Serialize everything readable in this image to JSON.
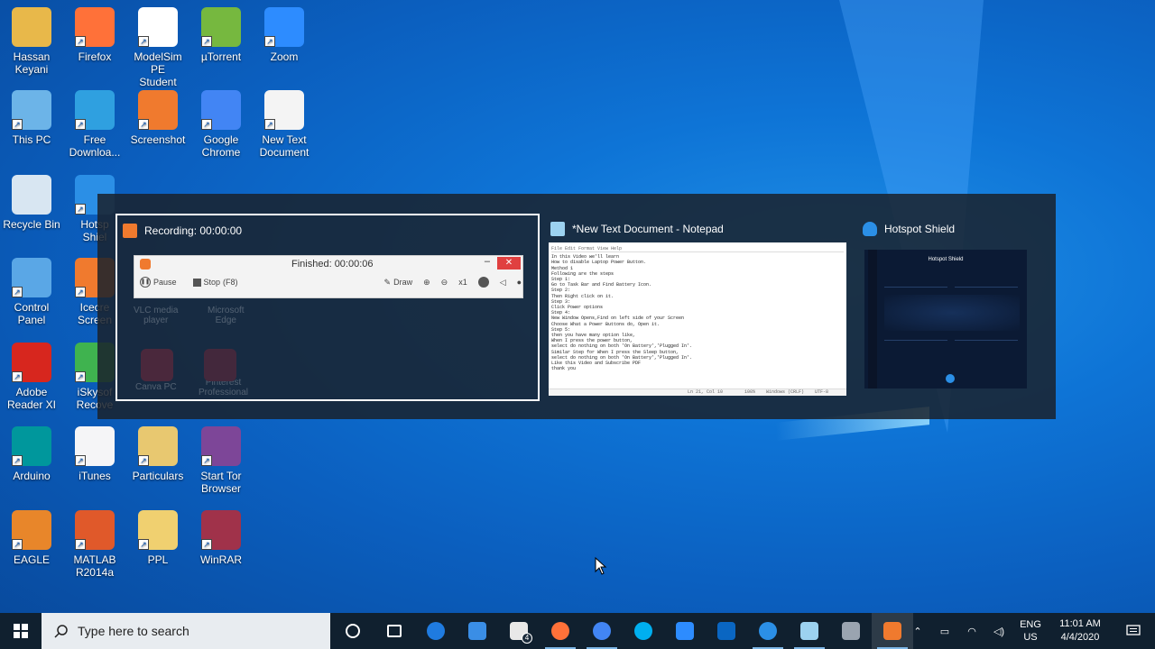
{
  "desktop": {
    "icons": [
      {
        "label": "Hassan\nKeyani",
        "icon": "user-folder-icon",
        "color": "#e8b84a"
      },
      {
        "label": "Firefox",
        "icon": "firefox-icon",
        "color": "#ff7139"
      },
      {
        "label": "ModelSim PE\nStudent Edi...",
        "icon": "modelsim-icon",
        "color": "#ffffff"
      },
      {
        "label": "µTorrent",
        "icon": "utorrent-icon",
        "color": "#76b83f"
      },
      {
        "label": "Zoom",
        "icon": "zoom-icon",
        "color": "#2d8cff"
      },
      {
        "label": "This PC",
        "icon": "this-pc-icon",
        "color": "#6cb4e8"
      },
      {
        "label": "Free\nDownloa...",
        "icon": "free-download-icon",
        "color": "#2fa0e0"
      },
      {
        "label": "Screenshot",
        "icon": "screenshot-icon",
        "color": "#f07a2e"
      },
      {
        "label": "Google\nChrome",
        "icon": "chrome-icon",
        "color": "#4285f4"
      },
      {
        "label": "New Text\nDocument",
        "icon": "text-document-icon",
        "color": "#f4f4f4"
      },
      {
        "label": "Recycle Bin",
        "icon": "recycle-bin-icon",
        "color": "#d8e6f2"
      },
      {
        "label": "Hotsp\nShiel",
        "icon": "hotspot-shield-icon",
        "color": "#2b8fe6"
      },
      {
        "label": "Control\nPanel",
        "icon": "control-panel-icon",
        "color": "#5aa7e6"
      },
      {
        "label": "Icecre\nScreen",
        "icon": "icecream-icon",
        "color": "#f07a2e"
      },
      {
        "label": "Adobe\nReader XI",
        "icon": "adobe-reader-icon",
        "color": "#d7261e"
      },
      {
        "label": "iSkysof\nRecove",
        "icon": "iskysoft-icon",
        "color": "#3fb34f"
      },
      {
        "label": "Arduino",
        "icon": "arduino-icon",
        "color": "#00979c"
      },
      {
        "label": "iTunes",
        "icon": "itunes-icon",
        "color": "#f5f5f7"
      },
      {
        "label": "Particulars",
        "icon": "folder-icon",
        "color": "#e8c870"
      },
      {
        "label": "Start Tor\nBrowser",
        "icon": "tor-icon",
        "color": "#7d4698"
      },
      {
        "label": "EAGLE",
        "icon": "eagle-icon",
        "color": "#e8862a"
      },
      {
        "label": "MATLAB\nR2014a",
        "icon": "matlab-icon",
        "color": "#e0592a"
      },
      {
        "label": "PPL",
        "icon": "folder-icon",
        "color": "#f0d070"
      },
      {
        "label": "WinRAR",
        "icon": "winrar-icon",
        "color": "#a0324a"
      }
    ]
  },
  "switcher": {
    "recording": {
      "title": "Recording:  00:00:00",
      "finished_label": "Finished:  00:00:06",
      "pause_label": "Pause",
      "stop_label": "Stop",
      "stop_hotkey": "(F8)",
      "draw_label": "Draw",
      "zoom_label": "x1",
      "bg_texts": [
        "VLC media\nplayer",
        "Microsoft\nEdge",
        "Canva PC",
        "Pinterest\nProfessional"
      ],
      "accent": "#f07a2e"
    },
    "notepad": {
      "title": "*New Text Document - Notepad",
      "menu": "File  Edit  Format  View  Help",
      "lines": [
        "In this Video we'll learn",
        "How to disable Laptop Power Button.",
        "Method 1",
        "Following are the steps",
        "Step 1:",
        "Go to Task Bar and Find Battery Icon.",
        "Step 2:",
        "Then Right click on it.",
        "Step 3:",
        "Click Power options",
        "Step 4:",
        "New Window Opens,Find on left side of your Screen",
        "Choose What a Power Buttons do, Open it.",
        "Step 5:",
        "then you have many option like,",
        "When I press the power button,",
        "select do nothing on both 'On Battery','Plugged In'.",
        "Similar Step for When I press the Sleep button,",
        "select do nothing on both 'On Battery','Plugged In'.",
        "Like this Video and Subscribe PDF",
        "thank you"
      ],
      "status": "Ln 21, Col 10        100%    Windows (CRLF)    UTF-8"
    },
    "hotspot": {
      "title": "Hotspot Shield",
      "app_name": "Hotspot Shield",
      "accent": "#2b8fe6"
    }
  },
  "taskbar": {
    "search_placeholder": "Type here to search",
    "apps": [
      {
        "name": "cortana",
        "icon": "cortana-icon",
        "color": "#ffffff"
      },
      {
        "name": "task-view",
        "icon": "task-view-icon",
        "color": "#ffffff"
      },
      {
        "name": "edge",
        "icon": "edge-icon",
        "color": "#1f7be0"
      },
      {
        "name": "store",
        "icon": "store-icon",
        "color": "#3a8ee6"
      },
      {
        "name": "mail",
        "icon": "mail-icon",
        "color": "#e8e8e8",
        "badge": "4"
      },
      {
        "name": "firefox",
        "icon": "firefox-icon",
        "color": "#ff7139"
      },
      {
        "name": "chrome",
        "icon": "chrome-icon",
        "color": "#4285f4"
      },
      {
        "name": "skype",
        "icon": "skype-icon",
        "color": "#00aff0"
      },
      {
        "name": "zoom",
        "icon": "zoom-icon",
        "color": "#2d8cff"
      },
      {
        "name": "linkedin",
        "icon": "linkedin-icon",
        "color": "#0a66c2"
      },
      {
        "name": "hotspot-shield",
        "icon": "hotspot-shield-icon",
        "color": "#2b8fe6"
      },
      {
        "name": "notepad",
        "icon": "notepad-icon",
        "color": "#9cd2f0"
      },
      {
        "name": "bug-app",
        "icon": "bug-icon",
        "color": "#9aa4b0"
      },
      {
        "name": "recorder",
        "icon": "recorder-icon",
        "color": "#f07a2e"
      }
    ],
    "tray": {
      "lang_top": "ENG",
      "lang_bottom": "US",
      "time": "11:01 AM",
      "date": "4/4/2020"
    }
  }
}
